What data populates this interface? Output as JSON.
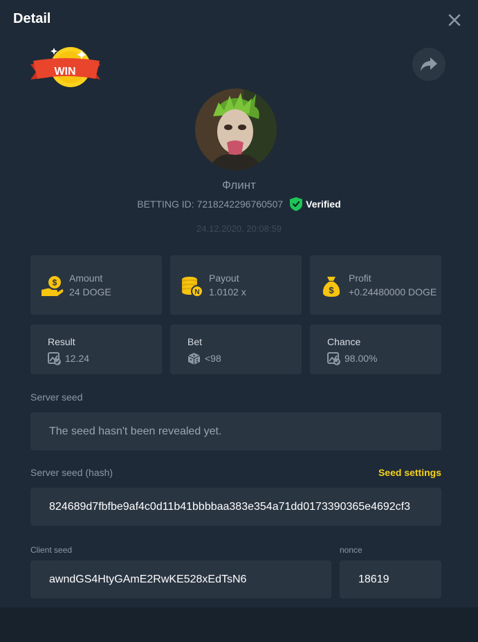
{
  "window": {
    "title": "Detail",
    "close_icon": "close-icon"
  },
  "badge": {
    "text": "WIN"
  },
  "user": {
    "name": "Флинт",
    "betting_id_label": "BETTING ID:",
    "betting_id": "7218242296760507",
    "verified_label": "Verified",
    "timestamp": "24.12.2020, 20:08:59"
  },
  "stats": {
    "amount": {
      "label": "Amount",
      "value": "24 DOGE",
      "icon": "hand-coin-icon"
    },
    "payout": {
      "label": "Payout",
      "value": "1.0102 x",
      "icon": "coin-stack-icon"
    },
    "profit": {
      "label": "Profit",
      "value": "+0.24480000 DOGE",
      "icon": "money-bag-icon"
    },
    "result": {
      "label": "Result",
      "value": "12.24",
      "icon": "chart-check-icon"
    },
    "bet": {
      "label": "Bet",
      "value": "<98",
      "icon": "dice-icon"
    },
    "chance": {
      "label": "Chance",
      "value": "98.00%",
      "icon": "chart-check-icon"
    }
  },
  "server_seed": {
    "label": "Server seed",
    "value": "The seed hasn't been revealed yet."
  },
  "server_seed_hash": {
    "label": "Server seed (hash)",
    "settings_link": "Seed settings",
    "value": "824689d7fbfbe9af4c0d11b41bbbbaa383e354a71dd0173390365e4692cf3"
  },
  "client_seed": {
    "label": "Client seed",
    "value": "awndGS4HtyGAmE2RwKE528xEdTsN6"
  },
  "nonce": {
    "label": "nonce",
    "value": "18619"
  },
  "colors": {
    "background": "#1e2a37",
    "card": "#2a3542",
    "accent_yellow": "#f7d21a",
    "verified_green": "#1fc45a",
    "win_red": "#e8452c"
  }
}
